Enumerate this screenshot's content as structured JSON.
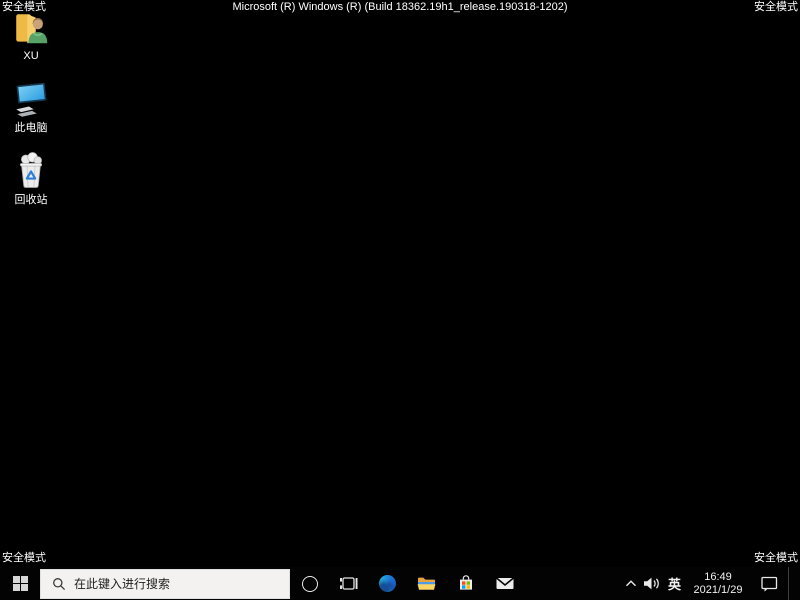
{
  "system": {
    "safe_mode_label": "安全模式",
    "build_banner": "Microsoft (R) Windows (R) (Build 18362.19h1_release.190318-1202)"
  },
  "desktop": {
    "icons": [
      {
        "id": "user-folder-icon",
        "label": "XU"
      },
      {
        "id": "this-pc-icon",
        "label": "此电脑"
      },
      {
        "id": "recycle-bin-icon",
        "label": "回收站"
      }
    ]
  },
  "taskbar": {
    "search": {
      "placeholder": "在此键入进行搜索"
    },
    "apps": [
      "cortana",
      "task-view",
      "edge",
      "file-explorer",
      "store",
      "mail"
    ],
    "tray": {
      "ime": "英",
      "time": "16:49",
      "date": "2021/1/29"
    }
  },
  "colors": {
    "desktop_bg": "#000000",
    "taskbar_bg": "#030303",
    "search_bg": "#f3f2f1",
    "text": "#ffffff",
    "folder_yellow": "#f7c24a",
    "explorer_blue": "#4d9be8",
    "store_red": "#f25022",
    "store_green": "#7fba00",
    "store_blue": "#00a4ef",
    "store_yellow": "#ffb900"
  }
}
